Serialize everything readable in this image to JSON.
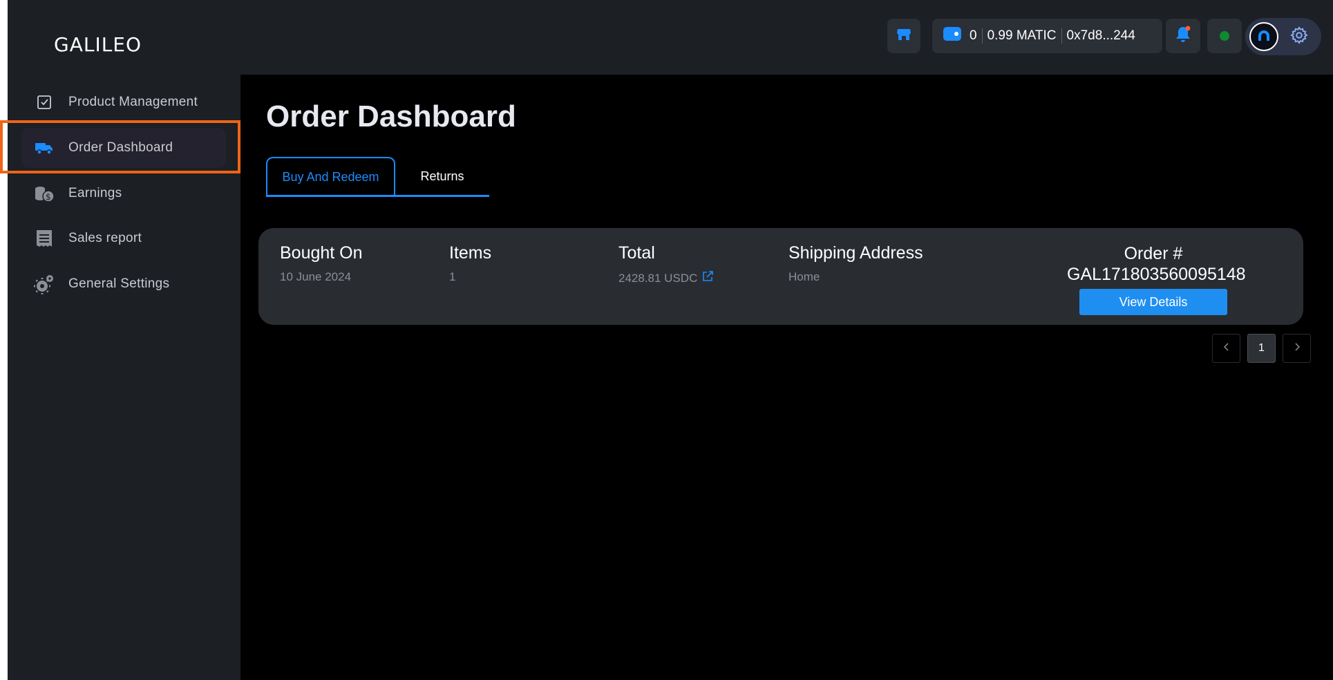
{
  "brand": {
    "logo_text": "GALILEO"
  },
  "header": {
    "wallet": {
      "token_count": "0",
      "matic_balance": "0.99 MATIC",
      "address": "0x7d8...244"
    },
    "icons": [
      "store-icon",
      "wallet-icon",
      "bell-icon",
      "status-dot",
      "avatar",
      "gear-icon"
    ]
  },
  "sidebar": {
    "items": [
      {
        "label": "Product Management",
        "icon": "checkbox-icon"
      },
      {
        "label": "Order Dashboard",
        "icon": "truck-icon",
        "active": true
      },
      {
        "label": "Earnings",
        "icon": "coins-icon"
      },
      {
        "label": "Sales report",
        "icon": "receipt-icon"
      },
      {
        "label": "General Settings",
        "icon": "gears-icon"
      }
    ]
  },
  "main": {
    "title": "Order Dashboard",
    "tabs": [
      {
        "label": "Buy And Redeem",
        "active": true
      },
      {
        "label": "Returns",
        "active": false
      }
    ],
    "order": {
      "bought_on_label": "Bought On",
      "bought_on_value": "10 June 2024",
      "items_label": "Items",
      "items_value": "1",
      "total_label": "Total",
      "total_value": "2428.81 USDC",
      "shipping_label": "Shipping Address",
      "shipping_value": "Home",
      "order_label": "Order #",
      "order_id": "GAL171803560095148",
      "view_details": "View Details"
    },
    "pagination": {
      "current_page": "1"
    }
  },
  "colors": {
    "accent": "#1a8cff",
    "highlight": "#f06418",
    "sidebar_bg": "#1c1f24",
    "card_bg": "#292d32",
    "status_online": "#0e8a2f"
  }
}
